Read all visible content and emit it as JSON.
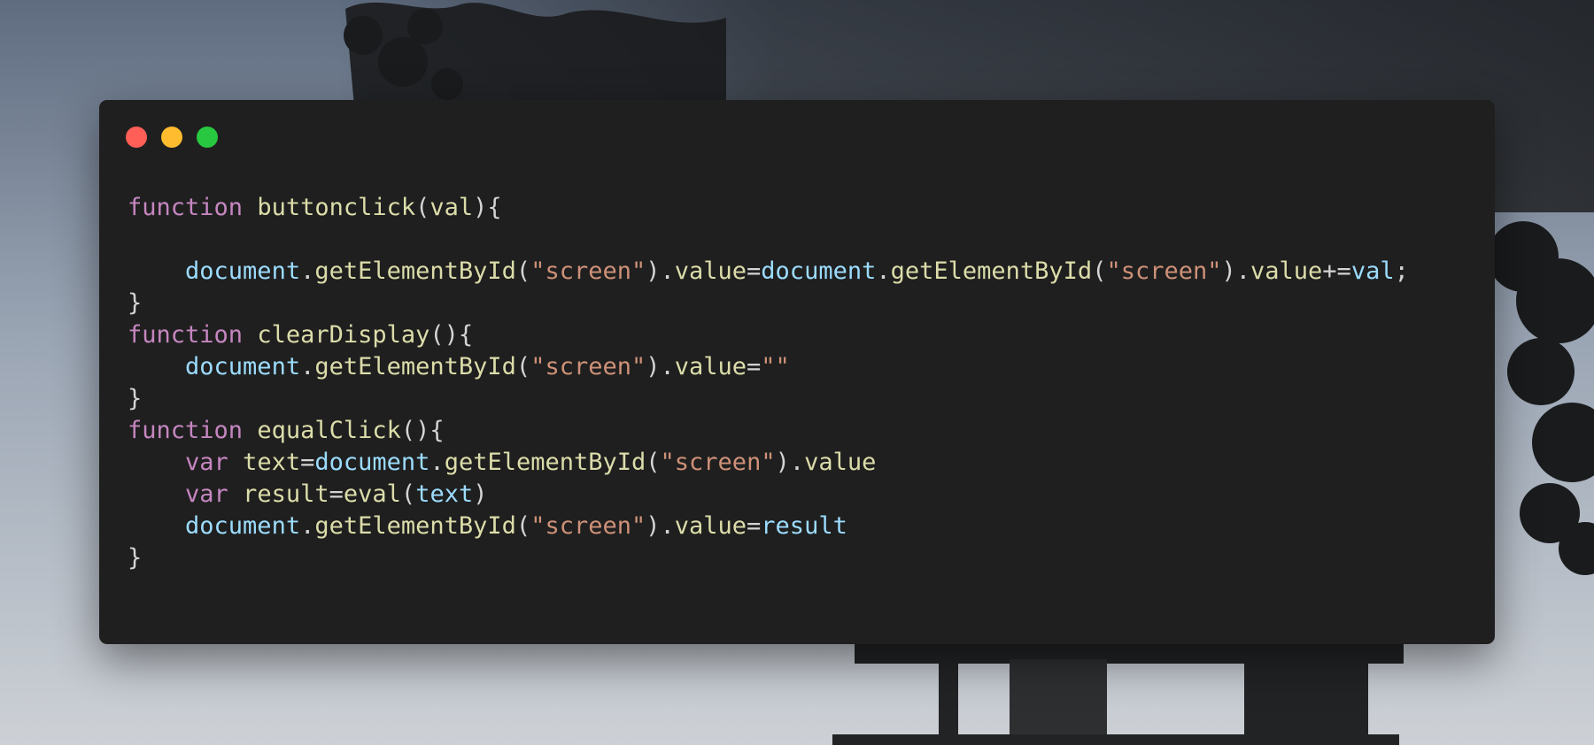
{
  "window": {
    "controls": {
      "close": {
        "color": "#ff5f57"
      },
      "minimize": {
        "color": "#febc2e"
      },
      "maximize": {
        "color": "#28c840"
      }
    }
  },
  "code": {
    "lines": [
      [
        {
          "t": "function",
          "c": "kw"
        },
        {
          "t": " ",
          "c": "pun"
        },
        {
          "t": "buttonclick",
          "c": "fn"
        },
        {
          "t": "(",
          "c": "pun"
        },
        {
          "t": "val",
          "c": "fn"
        },
        {
          "t": "){",
          "c": "pun"
        }
      ],
      [],
      [
        {
          "t": "    ",
          "c": "pun"
        },
        {
          "t": "document",
          "c": "obj"
        },
        {
          "t": ".",
          "c": "pun"
        },
        {
          "t": "getElementById",
          "c": "fn"
        },
        {
          "t": "(",
          "c": "pun"
        },
        {
          "t": "\"screen\"",
          "c": "str"
        },
        {
          "t": ").",
          "c": "pun"
        },
        {
          "t": "value",
          "c": "fn"
        },
        {
          "t": "=",
          "c": "pun"
        },
        {
          "t": "document",
          "c": "obj"
        },
        {
          "t": ".",
          "c": "pun"
        },
        {
          "t": "getElementById",
          "c": "fn"
        },
        {
          "t": "(",
          "c": "pun"
        },
        {
          "t": "\"screen\"",
          "c": "str"
        },
        {
          "t": ").",
          "c": "pun"
        },
        {
          "t": "value",
          "c": "fn"
        },
        {
          "t": "+=",
          "c": "pun"
        },
        {
          "t": "val",
          "c": "obj"
        },
        {
          "t": ";",
          "c": "pun"
        }
      ],
      [
        {
          "t": "}",
          "c": "pun"
        }
      ],
      [
        {
          "t": "function",
          "c": "kw"
        },
        {
          "t": " ",
          "c": "pun"
        },
        {
          "t": "clearDisplay",
          "c": "fn"
        },
        {
          "t": "(){",
          "c": "pun"
        }
      ],
      [
        {
          "t": "    ",
          "c": "pun"
        },
        {
          "t": "document",
          "c": "obj"
        },
        {
          "t": ".",
          "c": "pun"
        },
        {
          "t": "getElementById",
          "c": "fn"
        },
        {
          "t": "(",
          "c": "pun"
        },
        {
          "t": "\"screen\"",
          "c": "str"
        },
        {
          "t": ").",
          "c": "pun"
        },
        {
          "t": "value",
          "c": "fn"
        },
        {
          "t": "=",
          "c": "pun"
        },
        {
          "t": "\"\"",
          "c": "str"
        }
      ],
      [
        {
          "t": "}",
          "c": "pun"
        }
      ],
      [
        {
          "t": "function",
          "c": "kw"
        },
        {
          "t": " ",
          "c": "pun"
        },
        {
          "t": "equalClick",
          "c": "fn"
        },
        {
          "t": "(){",
          "c": "pun"
        }
      ],
      [
        {
          "t": "    ",
          "c": "pun"
        },
        {
          "t": "var",
          "c": "kw"
        },
        {
          "t": " ",
          "c": "pun"
        },
        {
          "t": "text",
          "c": "fn"
        },
        {
          "t": "=",
          "c": "pun"
        },
        {
          "t": "document",
          "c": "obj"
        },
        {
          "t": ".",
          "c": "pun"
        },
        {
          "t": "getElementById",
          "c": "fn"
        },
        {
          "t": "(",
          "c": "pun"
        },
        {
          "t": "\"screen\"",
          "c": "str"
        },
        {
          "t": ").",
          "c": "pun"
        },
        {
          "t": "value",
          "c": "fn"
        }
      ],
      [
        {
          "t": "    ",
          "c": "pun"
        },
        {
          "t": "var",
          "c": "kw"
        },
        {
          "t": " ",
          "c": "pun"
        },
        {
          "t": "result",
          "c": "fn"
        },
        {
          "t": "=",
          "c": "pun"
        },
        {
          "t": "eval",
          "c": "fn"
        },
        {
          "t": "(",
          "c": "pun"
        },
        {
          "t": "text",
          "c": "obj"
        },
        {
          "t": ")",
          "c": "pun"
        }
      ],
      [
        {
          "t": "    ",
          "c": "pun"
        },
        {
          "t": "document",
          "c": "obj"
        },
        {
          "t": ".",
          "c": "pun"
        },
        {
          "t": "getElementById",
          "c": "fn"
        },
        {
          "t": "(",
          "c": "pun"
        },
        {
          "t": "\"screen\"",
          "c": "str"
        },
        {
          "t": ").",
          "c": "pun"
        },
        {
          "t": "value",
          "c": "fn"
        },
        {
          "t": "=",
          "c": "pun"
        },
        {
          "t": "result",
          "c": "obj"
        }
      ],
      [
        {
          "t": "}",
          "c": "pun"
        }
      ]
    ]
  }
}
